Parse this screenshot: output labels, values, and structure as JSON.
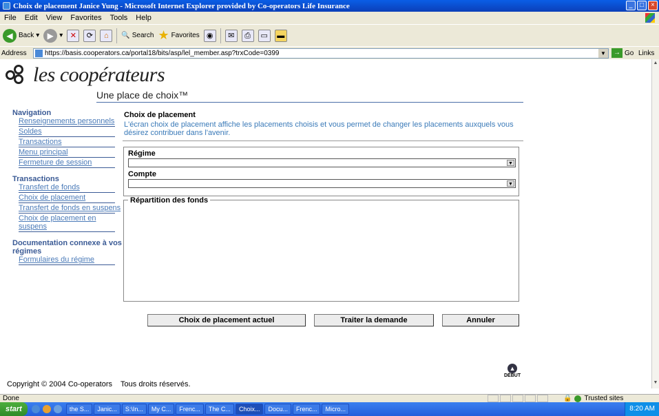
{
  "window": {
    "title": "Choix de placement Janice Yung - Microsoft Internet Explorer provided by Co-operators Life Insurance"
  },
  "menu": [
    "File",
    "Edit",
    "View",
    "Favorites",
    "Tools",
    "Help"
  ],
  "toolbar": {
    "back": "Back",
    "search": "Search",
    "favorites": "Favorites"
  },
  "address": {
    "label": "Address",
    "url": "https://basis.cooperators.ca/portal18/bits/asp/lel_member.asp?trxCode=0399",
    "go": "Go",
    "links": "Links"
  },
  "brand": {
    "title": "les coopérateurs",
    "tagline": "Une place de choix™"
  },
  "nav": {
    "navigation_header": "Navigation",
    "navigation_items": [
      "Renseignements personnels",
      "Soldes",
      "Transactions",
      "Menu principal",
      "Fermeture de session"
    ],
    "transactions_header": "Transactions",
    "transactions_items": [
      "Transfert de fonds",
      "Choix de placement",
      "Transfert de fonds en suspens",
      "Choix de placement en suspens"
    ],
    "docs_header": "Documentation connexe à vos régimes",
    "docs_items": [
      "Formulaires du régime"
    ]
  },
  "main": {
    "heading": "Choix de placement",
    "description": "L'écran choix de placement affiche les placements choisis et vous permet de changer les placements auxquels vous désirez contribuer dans l'avenir.",
    "regime_label": "Régime",
    "compte_label": "Compte",
    "repartition_label": "Répartition des fonds"
  },
  "buttons": {
    "current": "Choix de placement actuel",
    "process": "Traiter la demande",
    "cancel": "Annuler"
  },
  "debut": "DÉBUT",
  "footer": {
    "copyright": "Copyright © 2004 Co-operators    Tous droits réservés."
  },
  "status": {
    "text": "Done",
    "zone": "Trusted sites"
  },
  "taskbar": {
    "start": "start",
    "tasks": [
      "the S...",
      "Janic...",
      "S:\\In...",
      "My C...",
      "Frenc...",
      "The C...",
      "Choix...",
      "Docu...",
      "Frenc...",
      "Micro..."
    ],
    "time": "8:20 AM"
  }
}
